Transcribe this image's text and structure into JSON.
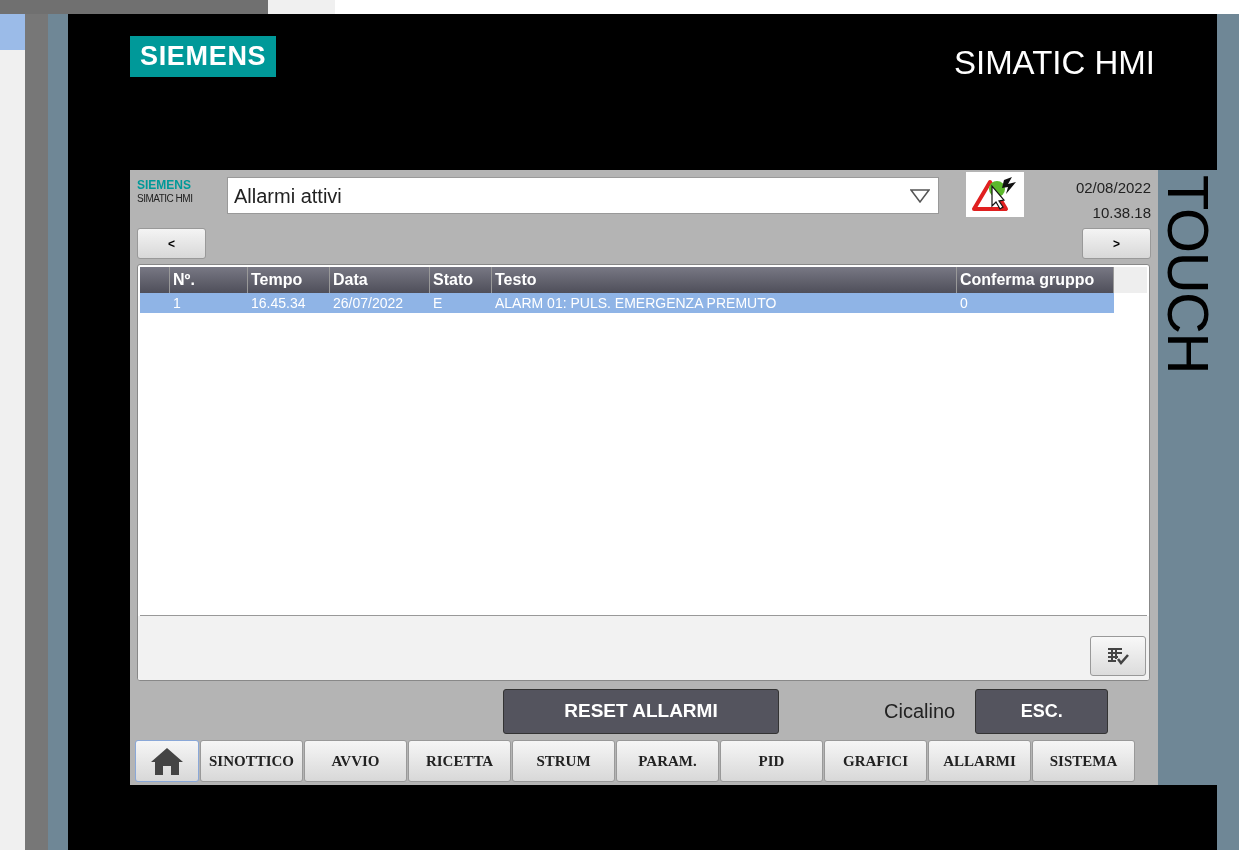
{
  "brand": {
    "logo": "SIEMENS",
    "product": "SIMATIC HMI",
    "side_label": "TOUCH"
  },
  "screen": {
    "logo": "SIEMENS",
    "logo_sub": "SIMATIC HMI",
    "view_select": {
      "value": "Allarmi attivi"
    },
    "date": "02/08/2022",
    "time": "10.38.18",
    "prev": "<",
    "next": ">"
  },
  "table": {
    "columns": [
      "Nº.",
      "Tempo",
      "Data",
      "Stato",
      "Testo",
      "Conferma gruppo"
    ],
    "rows": [
      {
        "cells": [
          "1",
          "16.45.34",
          "26/07/2022",
          "E",
          "ALARM 01: PULS. EMERGENZA PREMUTO",
          "0"
        ],
        "selected": true
      }
    ]
  },
  "actions": {
    "reset": "RESET ALLARMI",
    "buzzer_label": "Cicalino",
    "buzzer_button": "ESC."
  },
  "nav": [
    "SINOTTICO",
    "AVVIO",
    "RICETTA",
    "STRUM",
    "PARAM.",
    "PID",
    "GRAFICI",
    "ALLARMI",
    "SISTEMA"
  ]
}
